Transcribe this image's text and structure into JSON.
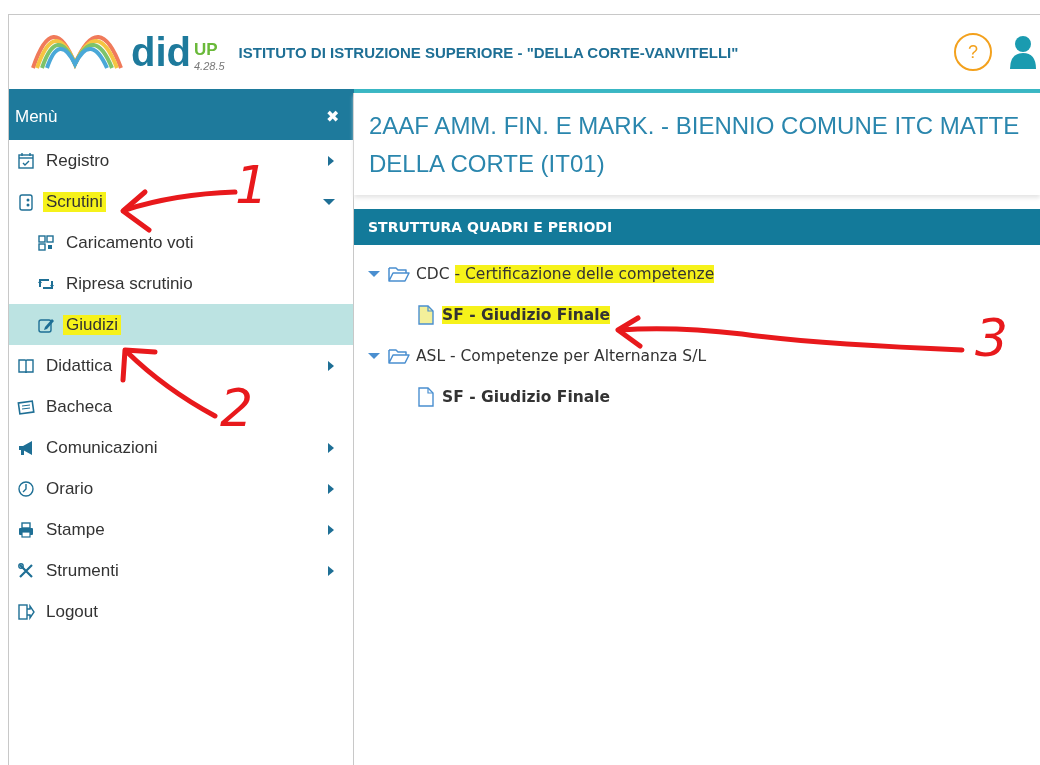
{
  "header": {
    "logo_text": "did",
    "logo_sup": "UP",
    "version": "4.28.5",
    "school": "ISTITUTO DI ISTRUZIONE SUPERIORE - \"DELLA CORTE-VANVITELLI\"",
    "help": "?"
  },
  "sidebar": {
    "title": "Menù",
    "close": "✖",
    "items": [
      {
        "label": "Registro",
        "kind": "group",
        "expanded": false,
        "highlighted": false,
        "selected": false
      },
      {
        "label": "Scrutini",
        "kind": "group",
        "expanded": true,
        "highlighted": true,
        "selected": false
      },
      {
        "label": "Caricamento voti",
        "kind": "subitem",
        "highlighted": false,
        "selected": false
      },
      {
        "label": "Ripresa scrutinio",
        "kind": "subitem",
        "highlighted": false,
        "selected": false
      },
      {
        "label": "Giudizi",
        "kind": "subitem",
        "highlighted": true,
        "selected": true
      },
      {
        "label": "Didattica",
        "kind": "group",
        "expanded": false,
        "highlighted": false,
        "selected": false
      },
      {
        "label": "Bacheca",
        "kind": "link",
        "highlighted": false,
        "selected": false
      },
      {
        "label": "Comunicazioni",
        "kind": "group",
        "expanded": false,
        "highlighted": false,
        "selected": false
      },
      {
        "label": "Orario",
        "kind": "group",
        "expanded": false,
        "highlighted": false,
        "selected": false
      },
      {
        "label": "Stampe",
        "kind": "group",
        "expanded": false,
        "highlighted": false,
        "selected": false
      },
      {
        "label": "Strumenti",
        "kind": "group",
        "expanded": false,
        "highlighted": false,
        "selected": false
      },
      {
        "label": "Logout",
        "kind": "link",
        "highlighted": false,
        "selected": false
      }
    ]
  },
  "content": {
    "title_lines": [
      "2AAF AMM. FIN. E MARK. - BIENNIO COMUNE ITC MATTE",
      "DELLA CORTE (IT01)"
    ],
    "section": "STRUTTURA QUADRI E PERIODI",
    "tree": [
      {
        "code": "CDC",
        "title": "- Certificazione delle competenze",
        "highlighted": true,
        "expanded": true,
        "children": [
          {
            "label": "SF - Giudizio Finale",
            "highlighted": true
          }
        ]
      },
      {
        "code": "ASL",
        "title": "- Competenze per Alternanza S/L",
        "highlighted": false,
        "expanded": true,
        "children": [
          {
            "label": "SF - Giudizio Finale",
            "highlighted": false
          }
        ]
      }
    ]
  },
  "annotations": [
    {
      "number": "1"
    },
    {
      "number": "2"
    },
    {
      "number": "3"
    }
  ]
}
